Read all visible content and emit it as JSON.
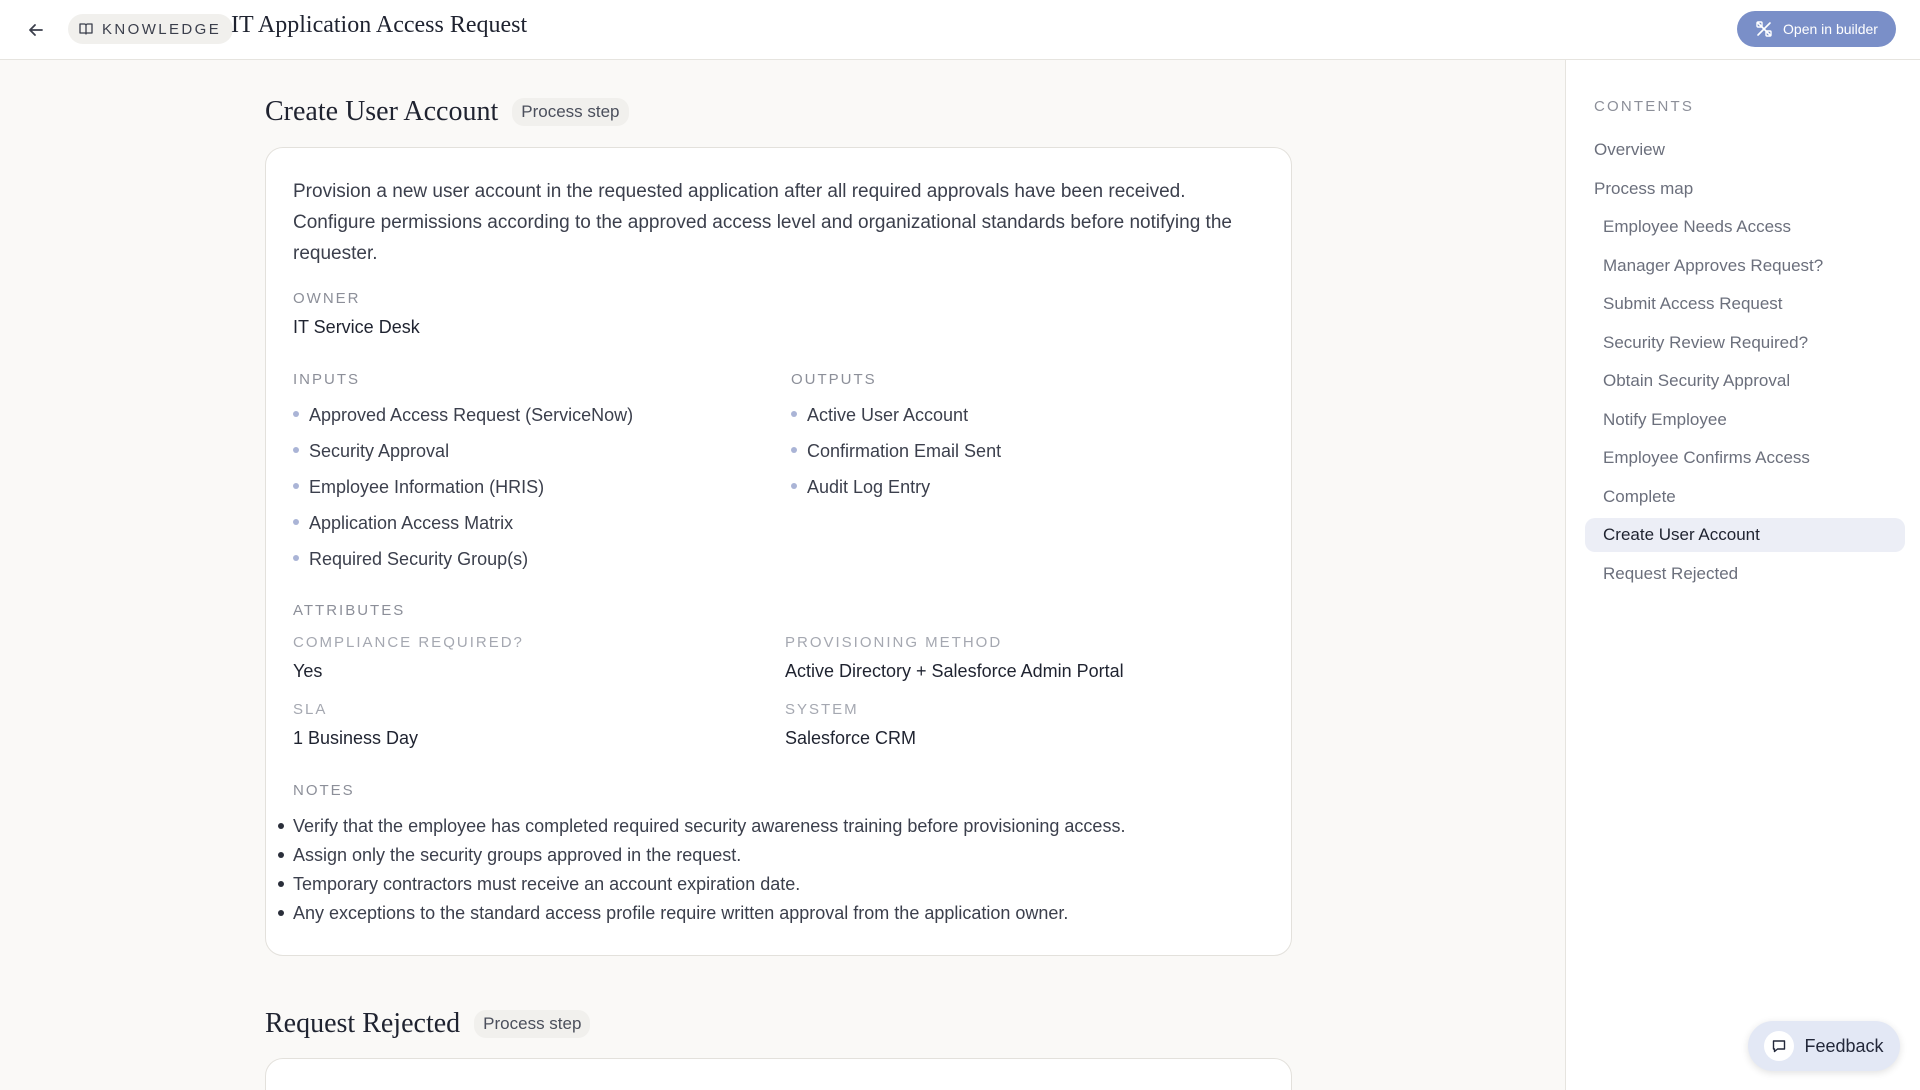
{
  "header": {
    "chip_label": "KNOWLEDGE",
    "title": "IT Application Access Request",
    "builder_label": "Open in builder"
  },
  "colors": {
    "accent": "#7a8fc8",
    "active_bg": "#eceef6",
    "bullet": "#aab4d6"
  },
  "icons": {
    "back": "arrow-left-icon",
    "chip": "book-icon",
    "builder": "builder-icon",
    "feedback": "chat-bubble-icon"
  },
  "sidebar": {
    "contents_label": "CONTENTS",
    "items": [
      {
        "label": "Overview",
        "level": "top",
        "active": false
      },
      {
        "label": "Process map",
        "level": "top",
        "active": false
      },
      {
        "label": "Employee Needs Access",
        "level": "sub",
        "active": false
      },
      {
        "label": "Manager Approves Request?",
        "level": "sub",
        "active": false
      },
      {
        "label": "Submit Access Request",
        "level": "sub",
        "active": false
      },
      {
        "label": "Security Review Required?",
        "level": "sub",
        "active": false
      },
      {
        "label": "Obtain Security Approval",
        "level": "sub",
        "active": false
      },
      {
        "label": "Notify Employee",
        "level": "sub",
        "active": false
      },
      {
        "label": "Employee Confirms Access",
        "level": "sub",
        "active": false
      },
      {
        "label": "Complete",
        "level": "sub",
        "active": false
      },
      {
        "label": "Create User Account",
        "level": "sub",
        "active": true
      },
      {
        "label": "Request Rejected",
        "level": "sub",
        "active": false
      }
    ]
  },
  "main": {
    "step": {
      "title": "Create User Account",
      "badge": "Process step",
      "description": "Provision a new user account in the requested application after all required approvals have been received. Configure permissions according to the approved access level and organizational standards before notifying the requester.",
      "owner_label": "OWNER",
      "owner": "IT Service Desk",
      "inputs_label": "INPUTS",
      "inputs": [
        "Approved Access Request (ServiceNow)",
        "Security Approval",
        "Employee Information (HRIS)",
        "Application Access Matrix",
        "Required Security Group(s)"
      ],
      "outputs_label": "OUTPUTS",
      "outputs": [
        "Active User Account",
        "Confirmation Email Sent",
        "Audit Log Entry"
      ],
      "attributes_label": "ATTRIBUTES",
      "attributes": [
        {
          "label": "COMPLIANCE REQUIRED?",
          "value": "Yes"
        },
        {
          "label": "PROVISIONING METHOD",
          "value": "Active Directory + Salesforce Admin Portal"
        },
        {
          "label": "SLA",
          "value": "1 Business Day"
        },
        {
          "label": "SYSTEM",
          "value": "Salesforce CRM"
        }
      ],
      "notes_label": "NOTES",
      "notes": [
        "Verify that the employee has completed required security awareness training before provisioning access.",
        "Assign only the security groups approved in the request.",
        "Temporary contractors must receive an account expiration date.",
        "Any exceptions to the standard access profile require written approval from the application owner."
      ]
    },
    "next_step": {
      "title": "Request Rejected",
      "badge": "Process step"
    }
  },
  "feedback": {
    "label": "Feedback"
  }
}
